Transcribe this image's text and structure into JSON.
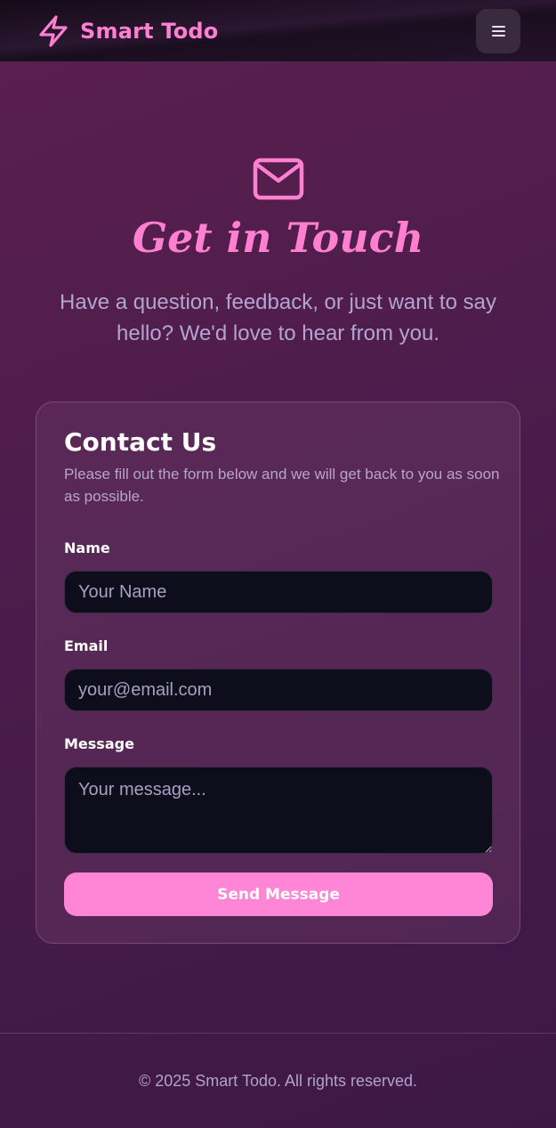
{
  "header": {
    "brand_name": "Smart Todo",
    "brand_icon": "lightning-bolt-icon",
    "menu_icon": "hamburger-menu-icon"
  },
  "hero": {
    "icon": "mail-icon",
    "title": "Get in Touch",
    "subtitle": "Have a question, feedback, or just want to say hello? We'd love to hear from you."
  },
  "contact_form": {
    "title": "Contact Us",
    "description": "Please fill out the form below and we will get back to you as soon as possible.",
    "name_label": "Name",
    "name_value": "",
    "name_placeholder": "Your Name",
    "email_label": "Email",
    "email_value": "",
    "email_placeholder": "your@email.com",
    "message_label": "Message",
    "message_value": "",
    "message_placeholder": "Your message...",
    "submit_label": "Send Message"
  },
  "footer": {
    "copyright": "© 2025 Smart Todo. All rights reserved."
  },
  "colors": {
    "accent": "#ff7fd0",
    "button": "#ff85d6",
    "input_bg": "#0e0d1c",
    "muted_text": "#b3a5cf"
  }
}
